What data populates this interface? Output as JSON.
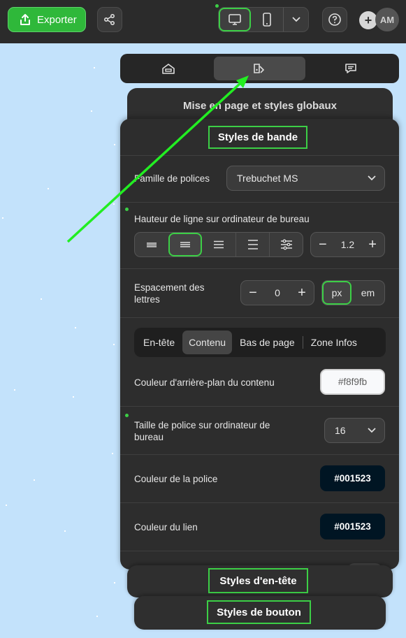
{
  "toolbar": {
    "export_label": "Exporter",
    "avatar_initials": "AM",
    "plus": "+"
  },
  "panel_tabs": [
    {
      "icon": "layout-icon",
      "active": false
    },
    {
      "icon": "style-paint-icon",
      "active": true
    },
    {
      "icon": "comment-icon",
      "active": false
    }
  ],
  "sections": {
    "global_title": "Mise en page et styles globaux",
    "band_title": "Styles de bande",
    "header_title": "Styles d'en-tête",
    "button_title": "Styles de bouton"
  },
  "font_family": {
    "label": "Famille de polices",
    "value": "Trebuchet MS"
  },
  "line_height": {
    "label": "Hauteur de ligne sur ordinateur de bureau",
    "value": "1.2",
    "minus": "−",
    "plus": "+",
    "selected_index": 1
  },
  "letter_spacing": {
    "label": "Espacement des lettres",
    "value": "0",
    "minus": "−",
    "plus": "+",
    "units": [
      "px",
      "em"
    ],
    "selected_unit": "px"
  },
  "sub_tabs": [
    "En-tête",
    "Contenu",
    "Bas de page",
    "Zone Infos"
  ],
  "selected_sub_tab": "Contenu",
  "content_bg": {
    "label": "Couleur d'arrière-plan du contenu",
    "value": "#f8f9fb"
  },
  "font_size": {
    "label": "Taille de police sur ordinateur de bureau",
    "value": "16"
  },
  "font_color": {
    "label": "Couleur de la police",
    "value": "#001523"
  },
  "link_color": {
    "label": "Couleur du lien",
    "value": "#001523"
  },
  "colors": {
    "accent_green": "#3ccf46",
    "export_green": "#2fb83a",
    "canvas_blue": "#c3e2fb",
    "panel_dark": "#2d2d2d"
  }
}
